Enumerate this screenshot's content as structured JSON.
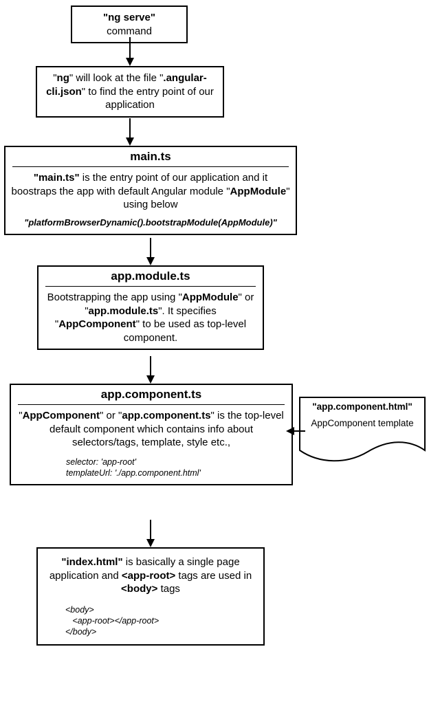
{
  "box1": {
    "line1_bold": "\"ng serve\"",
    "line2": "command"
  },
  "box2": {
    "seg1": "\"",
    "seg1b": "ng",
    "seg2": "\" will look at the file \"",
    "seg2b": ".angular-cli.json",
    "seg3": "\" to find the entry point of our application"
  },
  "box3": {
    "title": "main.ts",
    "seg1b": "\"main.ts\"",
    "seg2": " is the entry point of our application and it boostraps the app with default Angular module \"",
    "seg2b": "AppModule",
    "seg3": "\" using below",
    "code": "\"platformBrowserDynamic().bootstrapModule(AppModule)\""
  },
  "box4": {
    "title": "app.module.ts",
    "seg1": "Bootstrapping the app using \"",
    "seg1b": "AppModule",
    "seg2": "\" or \"",
    "seg2b": "app.module.ts",
    "seg3": "\". It specifies \"",
    "seg3b": "AppComponent",
    "seg4": "\" to be used as top-level component."
  },
  "box5": {
    "title": "app.component.ts",
    "seg1": "\"",
    "seg1b": "AppComponent",
    "seg2": "\" or \"",
    "seg2b": "app.component.ts",
    "seg3": "\" is the top-level default component which contains info about selectors/tags, template, style etc.,",
    "code1": "selector: 'app-root'",
    "code2": "templateUrl: './app.component.html'"
  },
  "doc": {
    "title": "\"app.component.html\"",
    "sub": "AppComponent template"
  },
  "box6": {
    "seg1b": "\"index.html\"",
    "seg2": " is basically a single page application and ",
    "seg2b": "<app-root>",
    "seg3": " tags are used in ",
    "seg3b": "<body>",
    "seg4": " tags",
    "code": "<body>\n   <app-root></app-root>\n</body>"
  }
}
